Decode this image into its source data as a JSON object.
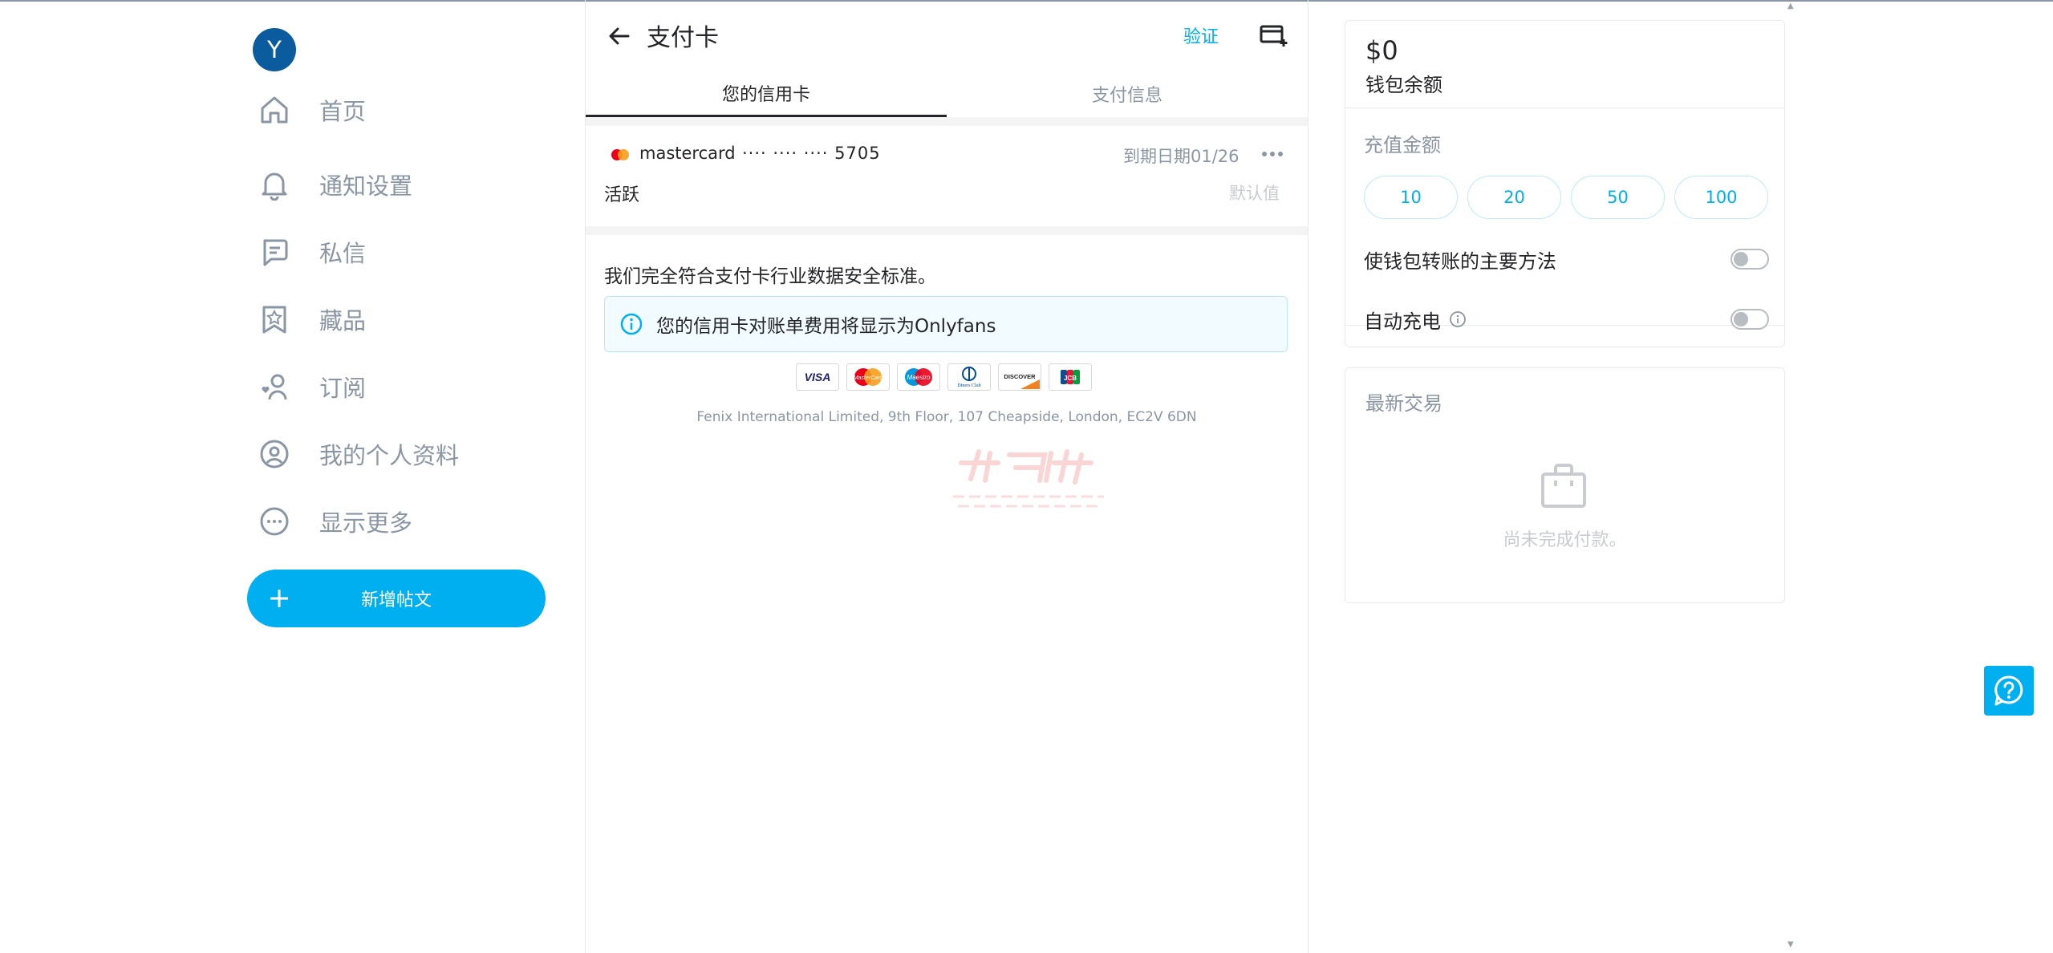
{
  "user": {
    "avatar_letter": "Y"
  },
  "nav": {
    "items": [
      {
        "label": "首页",
        "icon": "home-icon"
      },
      {
        "label": "通知设置",
        "icon": "bell-icon"
      },
      {
        "label": "私信",
        "icon": "message-icon"
      },
      {
        "label": "藏品",
        "icon": "collections-icon"
      },
      {
        "label": "订阅",
        "icon": "subscriptions-icon"
      },
      {
        "label": "我的个人资料",
        "icon": "profile-icon"
      },
      {
        "label": "显示更多",
        "icon": "more-icon"
      }
    ],
    "new_post_label": "新增帖文"
  },
  "header": {
    "title": "支付卡",
    "verify_label": "验证"
  },
  "tabs": [
    {
      "label": "您的信用卡",
      "active": true
    },
    {
      "label": "支付信息",
      "active": false
    }
  ],
  "card": {
    "brand": "mastercard",
    "masked": "···· ···· ···· 5705",
    "expiry": "到期日期01/26",
    "status": "活跃",
    "default_label": "默认值"
  },
  "security": {
    "pci_text": "我们完全符合支付卡行业数据安全标准。",
    "billing_notice": "您的信用卡对账单费用将显示为Onlyfans",
    "accepted_cards": [
      "VISA",
      "MasterCard",
      "Maestro",
      "Diners Club",
      "DISCOVER",
      "JCB"
    ],
    "address": "Fenix International Limited, 9th Floor, 107 Cheapside, London, EC2V 6DN"
  },
  "wallet": {
    "balance": "$0",
    "balance_label": "钱包余额",
    "topup_label": "充值金额",
    "amounts": [
      "10",
      "20",
      "50",
      "100"
    ],
    "primary_method_label": "使钱包转账的主要方法",
    "primary_method_on": false,
    "auto_recharge_label": "自动充电",
    "auto_recharge_on": false
  },
  "transactions": {
    "title": "最新交易",
    "empty_text": "尚未完成付款。"
  },
  "colors": {
    "accent": "#00aff0",
    "muted": "#8a96a3",
    "avatar_bg": "#0b5c9e",
    "text": "#242529"
  }
}
